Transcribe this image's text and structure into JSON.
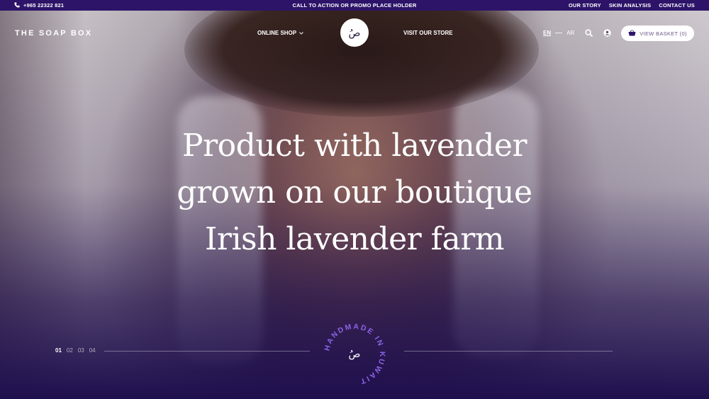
{
  "topbar": {
    "phone": "+965 22322 821",
    "promo": "CALL TO ACTION OR PROMO PLACE HOLDER",
    "links": [
      "OUR STORY",
      "SKIN ANALYSIS",
      "CONTACT US"
    ]
  },
  "nav": {
    "brand": "THE SOAP BOX",
    "shop": "ONLINE SHOP",
    "store": "VISIT OUR STORE",
    "lang_en": "EN",
    "lang_ar": "AR",
    "basket": "VIEW BASKET (0)"
  },
  "hero": {
    "headline": [
      "Product with lavender",
      "grown on our boutique",
      "Irish lavender farm"
    ],
    "pager": [
      "01",
      "02",
      "03",
      "04"
    ],
    "active_slide": 0,
    "stamp_text": "HANDMADE IN KUWAIT",
    "logo_glyph": "صُ"
  },
  "colors": {
    "topbar": "#2d1469",
    "accent": "#7a52d6"
  },
  "icons": {
    "phone": "phone-icon",
    "search": "search-icon",
    "account": "user-icon",
    "basket": "basket-icon",
    "chevron": "chevron-down-icon"
  }
}
